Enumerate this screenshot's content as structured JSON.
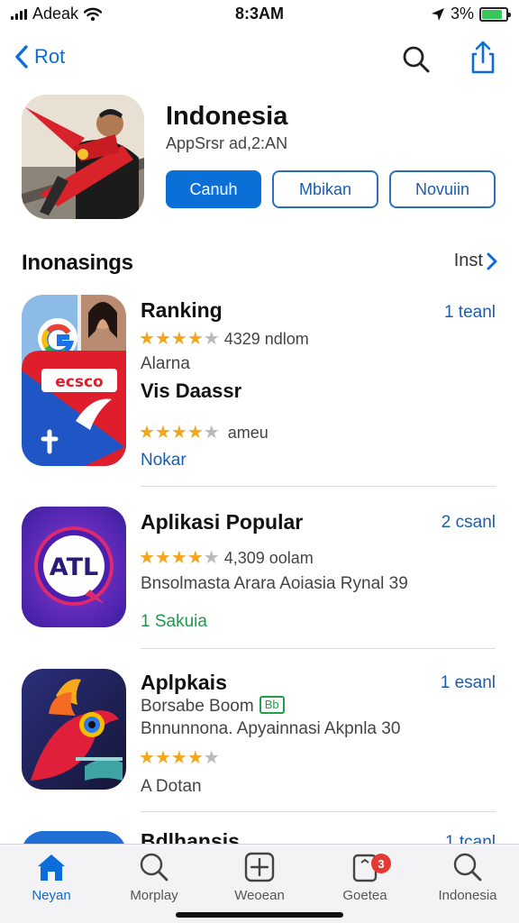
{
  "status_bar": {
    "carrier": "Adeak",
    "time": "8:3AM",
    "battery_pct": "3%",
    "battery_level": 0.85
  },
  "nav": {
    "back_label": "Rot",
    "icons": [
      "chevron-left-icon",
      "search-icon",
      "share-icon"
    ]
  },
  "app": {
    "title": "Indonesia",
    "subtitle": "AppSrsr ad,2:AN",
    "buttons": {
      "primary": "Canuh",
      "secondary": "Mbikan",
      "tertiary": "Novuiin"
    }
  },
  "section": {
    "title": "Inonasings",
    "see_all": "Inst"
  },
  "items": [
    {
      "name": "Ranking",
      "action": "1 teanl",
      "rating": 4,
      "rating_text": "4329 ndlom",
      "line1": "Alarna",
      "subname": "Vis Daassr",
      "rating2": 4,
      "rating2_text": "ameu",
      "footer": "Nokar"
    },
    {
      "name": "Aplikasi Popular",
      "action": "2 csanl",
      "rating": 4,
      "rating_text": "4,309 oolam",
      "line1": "Bnsolmasta  Arara Aoiasia Rynal 39",
      "footer": "1 Sakuia",
      "icon_text": "ATL"
    },
    {
      "name": "Aplpkais",
      "action": "1 esanl",
      "line1": "Borsabe Boom",
      "tag": "Bb",
      "line2": "Bnnunnona. Apyainnasi Akpnla 30",
      "rating": 4,
      "footer": "A Dotan"
    },
    {
      "name": "Bdlhansis",
      "action": "1 tcanl"
    }
  ],
  "tabs": [
    {
      "label": "Neyan",
      "icon": "home-icon",
      "active": true
    },
    {
      "label": "Morplay",
      "icon": "search-icon"
    },
    {
      "label": "Weoean",
      "icon": "plus-square-icon"
    },
    {
      "label": "Goetea",
      "icon": "device-icon",
      "badge": "3"
    },
    {
      "label": "Indonesia",
      "icon": "search-icon"
    }
  ],
  "colors": {
    "accent": "#0b6fd8",
    "star": "#f2a71b",
    "green": "#1a9a46",
    "badge": "#e53935"
  }
}
